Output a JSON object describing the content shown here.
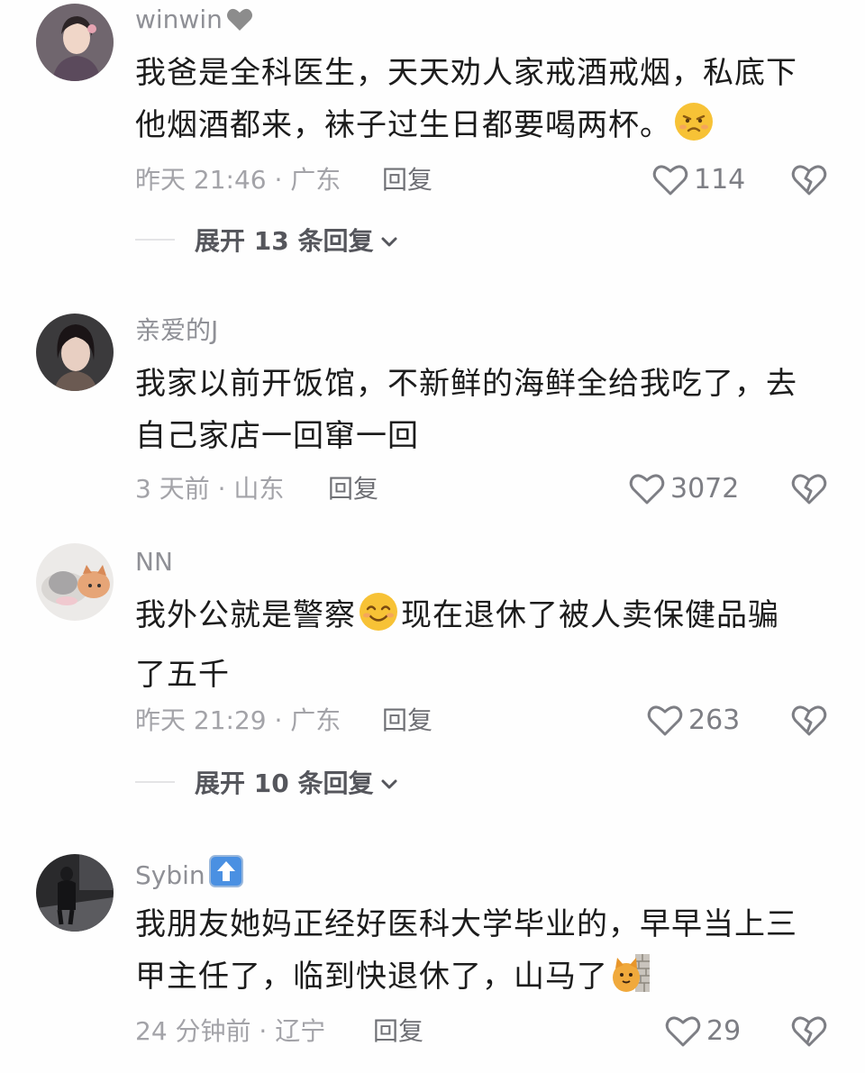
{
  "comments": [
    {
      "username": "winwin",
      "badge_icon": "grey-heart",
      "lines": [
        "我爸是全科医生，天天劝人家戒酒戒烟，私底下",
        "他烟酒都来，袜子过生日都要喝两杯。"
      ],
      "emoji": "frowning-face",
      "time": "昨天 21:46 · 广东",
      "reply_label": "回复",
      "likes": "114",
      "expand_label": "展开 13 条回复"
    },
    {
      "username": "亲爱的J",
      "lines": [
        "我家以前开饭馆，不新鲜的海鲜全给我吃了，去",
        "自己家店一回窜一回"
      ],
      "time": "3 天前 · 山东",
      "reply_label": "回复",
      "likes": "3072"
    },
    {
      "username": "NN",
      "lines_pre": "我外公就是警察",
      "lines_post": "现在退休了被人卖保健品骗",
      "line2": "了五千",
      "emoji": "smiling-face",
      "time": "昨天 21:29 · 广东",
      "reply_label": "回复",
      "likes": "263",
      "expand_label": "展开 10 条回复"
    },
    {
      "username": "Sybin",
      "badge_icon": "up-arrow-square",
      "line1": "我朋友她妈正经好医科大学毕业的，早早当上三",
      "line2": "甲主任了，临到快退休了，山马了",
      "emoji": "cat-wall",
      "time": "24 分钟前 · 辽宁",
      "reply_label": "回复",
      "likes": "29"
    }
  ],
  "colors": {
    "text": "#1c1c1c",
    "meta": "#a3a3a8",
    "username": "#8f9096",
    "emoji_yellow": "#f7c236"
  }
}
